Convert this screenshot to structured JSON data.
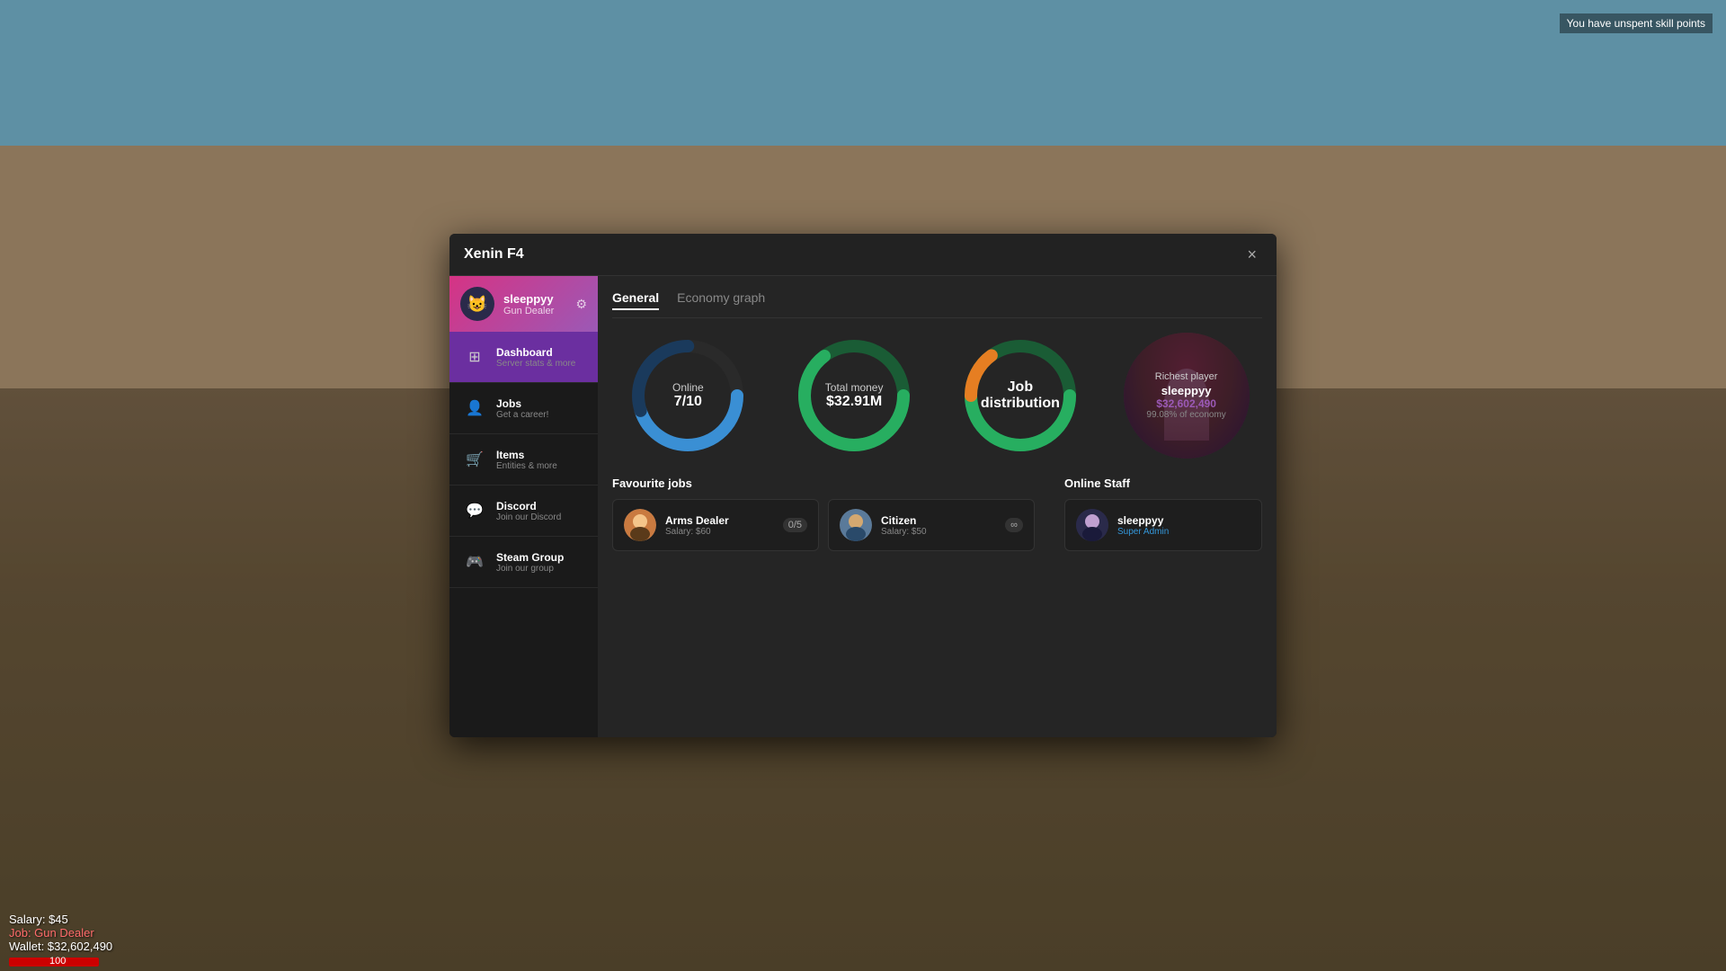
{
  "hud": {
    "notification": "You have unspent skill points",
    "salary_label": "Salary: $45",
    "job_label": "Job: Gun Dealer",
    "wallet_label": "Wallet: $32,602,490",
    "health": "100"
  },
  "modal": {
    "title": "Xenin F4",
    "close_label": "×"
  },
  "user": {
    "name": "sleeppyy",
    "job": "Gun Dealer",
    "avatar_emoji": "😺"
  },
  "sidebar": {
    "nav_items": [
      {
        "id": "dashboard",
        "label": "Dashboard",
        "sublabel": "Server stats & more",
        "icon": "⊞",
        "active": true
      },
      {
        "id": "jobs",
        "label": "Jobs",
        "sublabel": "Get a career!",
        "icon": "👤",
        "active": false
      },
      {
        "id": "items",
        "label": "Items",
        "sublabel": "Entities & more",
        "icon": "🛒",
        "active": false
      },
      {
        "id": "discord",
        "label": "Discord",
        "sublabel": "Join our Discord",
        "icon": "💬",
        "active": false
      },
      {
        "id": "steam",
        "label": "Steam Group",
        "sublabel": "Join our group",
        "icon": "🎮",
        "active": false
      }
    ]
  },
  "tabs": [
    {
      "label": "General",
      "active": true
    },
    {
      "label": "Economy graph",
      "active": false
    }
  ],
  "stats": {
    "online": {
      "label": "Online",
      "value": "7/10",
      "current": 7,
      "max": 10
    },
    "total_money": {
      "label": "Total money",
      "value": "$32.91M"
    },
    "job_distribution": {
      "label": "Job distribution"
    },
    "richest": {
      "title": "Richest player",
      "name": "sleeppyy",
      "amount": "$32,602,490",
      "percent": "99.08% of economy"
    }
  },
  "favourite_jobs": {
    "title": "Favourite jobs",
    "jobs": [
      {
        "name": "Arms Dealer",
        "salary": "Salary: $60",
        "slots": "0/5",
        "avatar_emoji": "👨"
      },
      {
        "name": "Citizen",
        "salary": "Salary: $50",
        "slots": "∞",
        "avatar_emoji": "👨‍🦱"
      }
    ]
  },
  "online_staff": {
    "title": "Online Staff",
    "staff": [
      {
        "name": "sleeppyy",
        "role": "Super Admin",
        "role_color": "super-admin",
        "avatar_emoji": "😺"
      }
    ]
  }
}
